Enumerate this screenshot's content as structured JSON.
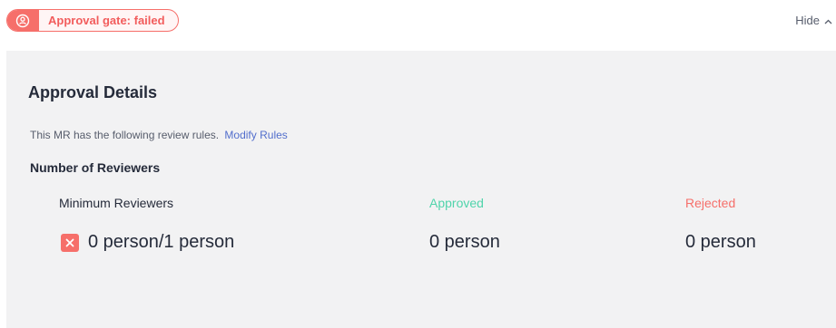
{
  "header": {
    "gate_status_label": "Approval gate: failed",
    "gate_icon": "user-lock-icon",
    "hide_label": "Hide",
    "hide_icon": "chevron-up-icon"
  },
  "panel": {
    "title": "Approval Details",
    "rules_text": "This MR has the following review rules.",
    "modify_rules_label": "Modify Rules",
    "section_title": "Number of Reviewers",
    "columns": {
      "minimum": {
        "label": "Minimum Reviewers",
        "value": "0 person/1 person",
        "status_icon": "error-x-icon"
      },
      "approved": {
        "label": "Approved",
        "value": "0 person"
      },
      "rejected": {
        "label": "Rejected",
        "value": "0 person"
      }
    }
  },
  "colors": {
    "error": "#f66f6a",
    "approved": "#50d4ab",
    "link": "#526ecc",
    "panel_bg": "#f2f2f3"
  }
}
